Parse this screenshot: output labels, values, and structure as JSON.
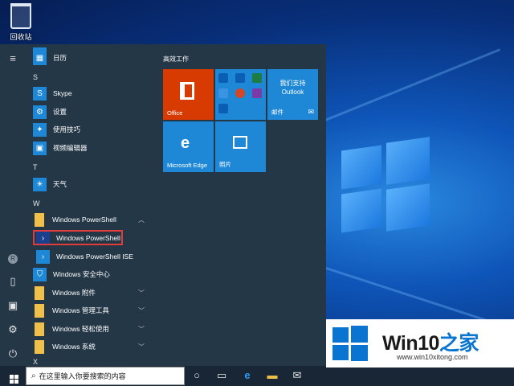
{
  "desktop": {
    "recycle_bin_label": "回收站"
  },
  "start_menu": {
    "letters": {
      "s": "S",
      "t": "T",
      "w": "W",
      "x": "X"
    },
    "apps": {
      "calendar": "日历",
      "skype": "Skype",
      "settings": "设置",
      "tips": "使用技巧",
      "video_editor": "视频编辑器",
      "weather": "天气",
      "powershell_folder": "Windows PowerShell",
      "powershell": "Windows PowerShell",
      "powershell_ise": "Windows PowerShell ISE",
      "security_center": "Windows 安全中心",
      "accessories": "Windows 附件",
      "admin_tools": "Windows 管理工具",
      "ease_of_access": "Windows 轻松使用",
      "system": "Windows 系统"
    },
    "tiles_group_title": "高效工作",
    "tiles": {
      "office": "Office",
      "support_title": "我们支持",
      "support_sub": "Outlook",
      "mail": "邮件",
      "edge": "Microsoft Edge",
      "photos": "照片"
    }
  },
  "taskbar": {
    "search_placeholder": "在这里输入你要搜索的内容"
  },
  "watermark": {
    "brand_a": "Win10",
    "brand_b": "之家",
    "url": "www.win10xitong.com"
  },
  "icons": {
    "hamburger": "hamburger-icon",
    "user": "user-icon",
    "documents": "document-icon",
    "pictures": "pictures-icon",
    "settings": "gear-icon",
    "power": "power-icon",
    "start": "windows-start-icon",
    "search": "search-icon",
    "cortana": "cortana-circle-icon",
    "task_view": "task-view-icon",
    "edge": "edge-icon",
    "explorer": "file-explorer-icon",
    "mail": "mail-icon"
  },
  "colors": {
    "start_bg": "#243747",
    "tile_blue": "#1e88d6",
    "office_orange": "#d83b01",
    "highlight_red": "#e13b3b",
    "folder_yellow": "#f1c04a"
  }
}
